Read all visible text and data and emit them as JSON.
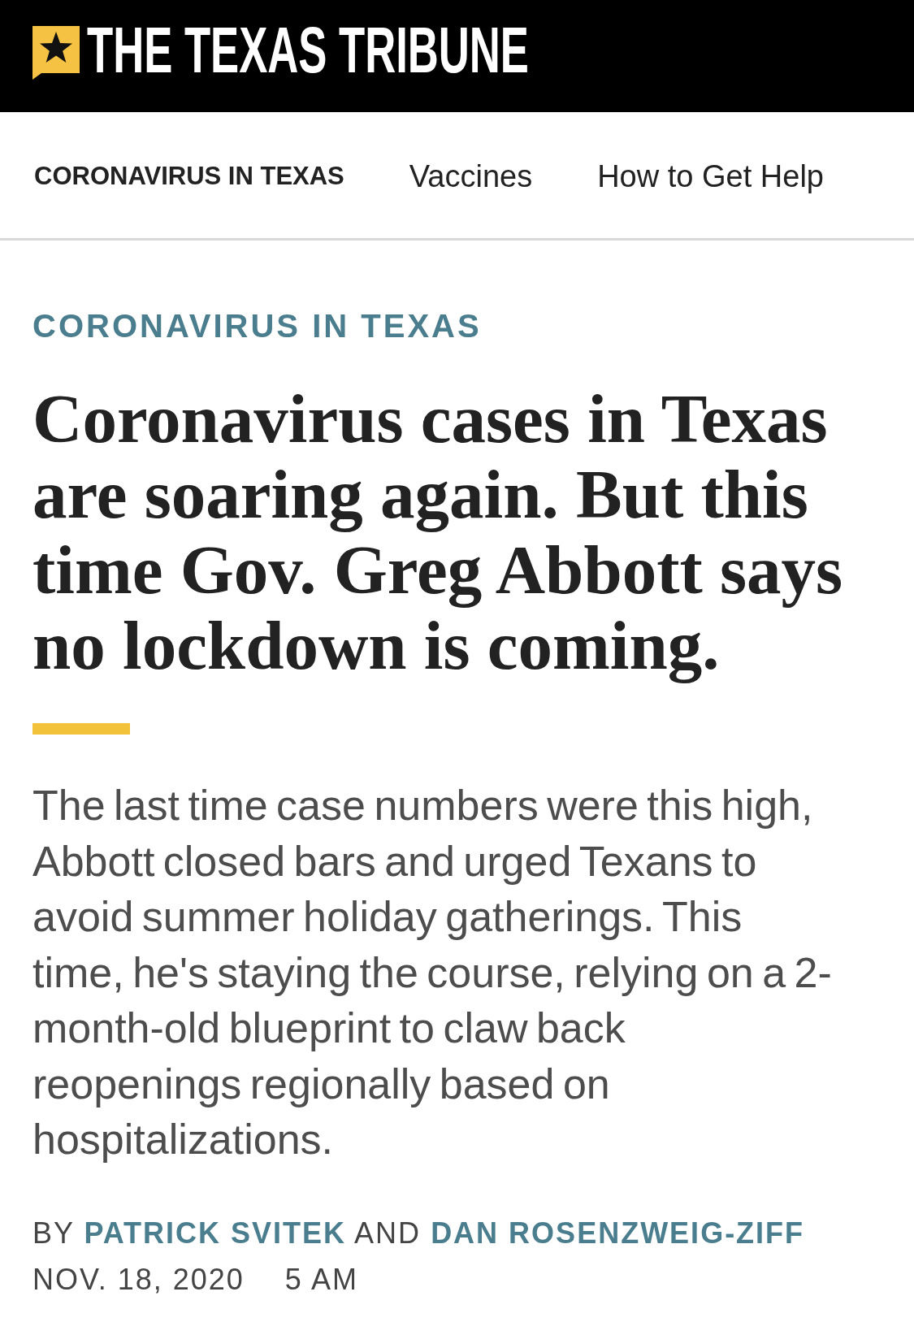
{
  "header": {
    "logo_text": "THE TEXAS TRIBUNE"
  },
  "nav": {
    "items": [
      {
        "label": "CORONAVIRUS IN TEXAS",
        "kind": "section"
      },
      {
        "label": "Vaccines",
        "kind": "link"
      },
      {
        "label": "How to Get Help",
        "kind": "link"
      }
    ]
  },
  "article": {
    "kicker": "CORONAVIRUS IN TEXAS",
    "headline": "Coronavirus cases in Texas are soaring again. But this time Gov. Greg Abbott says no lockdown is coming.",
    "summary": "The last time case numbers were this high, Abbott closed bars and urged Texans to avoid summer holiday gatherings. This time, he's staying the course, relying on a 2-month-old blueprint to claw back reopenings regionally based on hospitalizations.",
    "byline": {
      "prefix": "BY",
      "authors": [
        "PATRICK SVITEK",
        "DAN ROSENZWEIG-ZIFF"
      ],
      "conjunction": "AND"
    },
    "date": "NOV. 18, 2020",
    "time": "5 AM"
  }
}
